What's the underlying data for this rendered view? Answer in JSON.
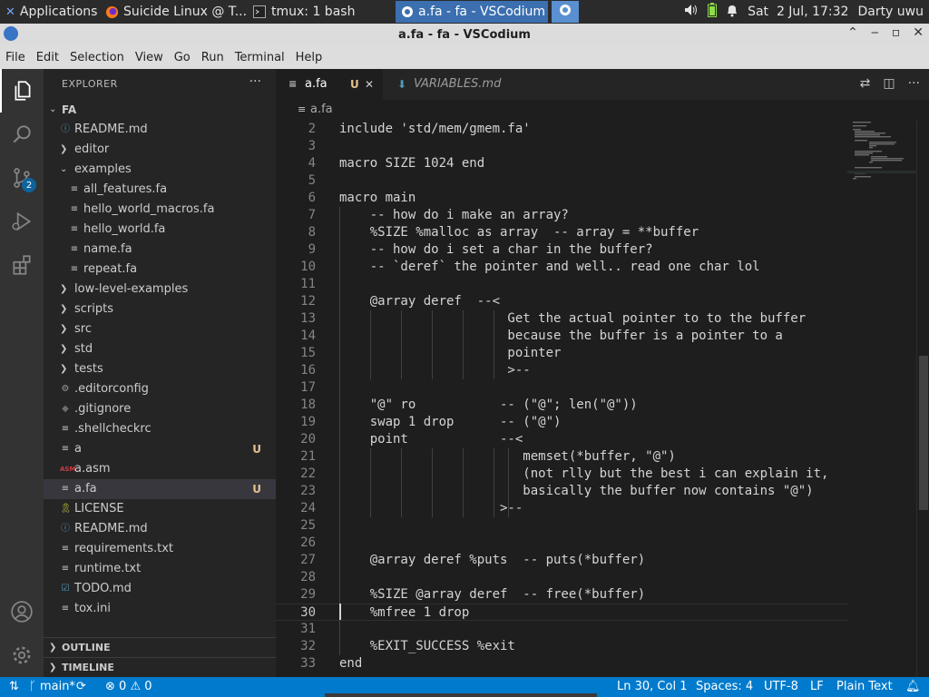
{
  "system_bar": {
    "applications": "Applications",
    "firefox_task": "Suicide Linux @ T...",
    "tmux_task": "tmux: 1 bash",
    "vscodium_task": "a.fa - fa - VSCodium",
    "datetime": "Sat  2 Jul, 17:32",
    "user": "Darty uwu"
  },
  "window": {
    "title": "a.fa - fa - VSCodium"
  },
  "menu": [
    "File",
    "Edit",
    "Selection",
    "View",
    "Go",
    "Run",
    "Terminal",
    "Help"
  ],
  "activity_bar": {
    "scm_badge": "2"
  },
  "explorer": {
    "header": "EXPLORER",
    "more": "···",
    "root": "FA",
    "items": [
      {
        "label": "README.md",
        "kind": "readme",
        "depth": 1,
        "twisty": ""
      },
      {
        "label": "editor",
        "kind": "folder",
        "depth": 1,
        "twisty": "closed"
      },
      {
        "label": "examples",
        "kind": "folder",
        "depth": 1,
        "twisty": "open"
      },
      {
        "label": "all_features.fa",
        "kind": "file",
        "depth": 2,
        "twisty": ""
      },
      {
        "label": "hello_world_macros.fa",
        "kind": "file",
        "depth": 2,
        "twisty": ""
      },
      {
        "label": "hello_world.fa",
        "kind": "file",
        "depth": 2,
        "twisty": ""
      },
      {
        "label": "name.fa",
        "kind": "file",
        "depth": 2,
        "twisty": ""
      },
      {
        "label": "repeat.fa",
        "kind": "file",
        "depth": 2,
        "twisty": ""
      },
      {
        "label": "low-level-examples",
        "kind": "folder",
        "depth": 1,
        "twisty": "closed"
      },
      {
        "label": "scripts",
        "kind": "folder",
        "depth": 1,
        "twisty": "closed"
      },
      {
        "label": "src",
        "kind": "folder",
        "depth": 1,
        "twisty": "closed"
      },
      {
        "label": "std",
        "kind": "folder",
        "depth": 1,
        "twisty": "closed"
      },
      {
        "label": "tests",
        "kind": "folder",
        "depth": 1,
        "twisty": "closed"
      },
      {
        "label": ".editorconfig",
        "kind": "gear",
        "depth": 1,
        "twisty": ""
      },
      {
        "label": ".gitignore",
        "kind": "git",
        "depth": 1,
        "twisty": ""
      },
      {
        "label": ".shellcheckrc",
        "kind": "file",
        "depth": 1,
        "twisty": ""
      },
      {
        "label": "a",
        "kind": "file",
        "depth": 1,
        "twisty": "",
        "status": "U"
      },
      {
        "label": "a.asm",
        "kind": "asm",
        "depth": 1,
        "twisty": ""
      },
      {
        "label": "a.fa",
        "kind": "file",
        "depth": 1,
        "twisty": "",
        "status": "U",
        "selected": true
      },
      {
        "label": "LICENSE",
        "kind": "license",
        "depth": 1,
        "twisty": ""
      },
      {
        "label": "README.md",
        "kind": "readme",
        "depth": 1,
        "twisty": ""
      },
      {
        "label": "requirements.txt",
        "kind": "file",
        "depth": 1,
        "twisty": ""
      },
      {
        "label": "runtime.txt",
        "kind": "file",
        "depth": 1,
        "twisty": ""
      },
      {
        "label": "TODO.md",
        "kind": "todo",
        "depth": 1,
        "twisty": ""
      },
      {
        "label": "tox.ini",
        "kind": "file",
        "depth": 1,
        "twisty": ""
      }
    ],
    "outline": "OUTLINE",
    "timeline": "TIMELINE"
  },
  "tabs": [
    {
      "label": "a.fa",
      "status": "U",
      "active": true
    },
    {
      "label": "VARIABLES.md",
      "active": false
    }
  ],
  "breadcrumb": "a.fa",
  "editor": {
    "current_line": 30,
    "lines": [
      {
        "n": "2",
        "text": "include 'std/mem/gmem.fa'"
      },
      {
        "n": "3",
        "text": ""
      },
      {
        "n": "4",
        "text": "macro SIZE 1024 end"
      },
      {
        "n": "5",
        "text": ""
      },
      {
        "n": "6",
        "text": "macro main"
      },
      {
        "n": "7",
        "text": "    -- how do i make an array?"
      },
      {
        "n": "8",
        "text": "    %SIZE %malloc as array  -- array = **buffer"
      },
      {
        "n": "9",
        "text": "    -- how do i set a char in the buffer?"
      },
      {
        "n": "10",
        "text": "    -- `deref` the pointer and well.. read one char lol"
      },
      {
        "n": "11",
        "text": ""
      },
      {
        "n": "12",
        "text": "    @array deref  --<"
      },
      {
        "n": "13",
        "text": "                      Get the actual pointer to to the buffer"
      },
      {
        "n": "14",
        "text": "                      because the buffer is a pointer to a"
      },
      {
        "n": "15",
        "text": "                      pointer"
      },
      {
        "n": "16",
        "text": "                      >--"
      },
      {
        "n": "17",
        "text": ""
      },
      {
        "n": "18",
        "text": "    \"@\" ro           -- (\"@\"; len(\"@\"))"
      },
      {
        "n": "19",
        "text": "    swap 1 drop      -- (\"@\")"
      },
      {
        "n": "20",
        "text": "    point            --<"
      },
      {
        "n": "21",
        "text": "                        memset(*buffer, \"@\")"
      },
      {
        "n": "22",
        "text": "                        (not rlly but the best i can explain it,"
      },
      {
        "n": "23",
        "text": "                        basically the buffer now contains \"@\")"
      },
      {
        "n": "24",
        "text": "                     >--"
      },
      {
        "n": "25",
        "text": ""
      },
      {
        "n": "26",
        "text": ""
      },
      {
        "n": "27",
        "text": "    @array deref %puts  -- puts(*buffer)"
      },
      {
        "n": "28",
        "text": ""
      },
      {
        "n": "29",
        "text": "    %SIZE @array deref  -- free(*buffer)"
      },
      {
        "n": "30",
        "text": "    %mfree 1 drop"
      },
      {
        "n": "31",
        "text": ""
      },
      {
        "n": "32",
        "text": "    %EXIT_SUCCESS %exit"
      },
      {
        "n": "33",
        "text": "end"
      }
    ]
  },
  "status_bar": {
    "branch": "main*",
    "errors": "0",
    "warnings": "0",
    "position": "Ln 30, Col 1",
    "spaces": "Spaces: 4",
    "encoding": "UTF-8",
    "eol": "LF",
    "language": "Plain Text"
  },
  "colors": {
    "accent": "#007acc",
    "untracked": "#e2c08d",
    "sidebar": "#252526",
    "editor": "#1e1e1e"
  }
}
